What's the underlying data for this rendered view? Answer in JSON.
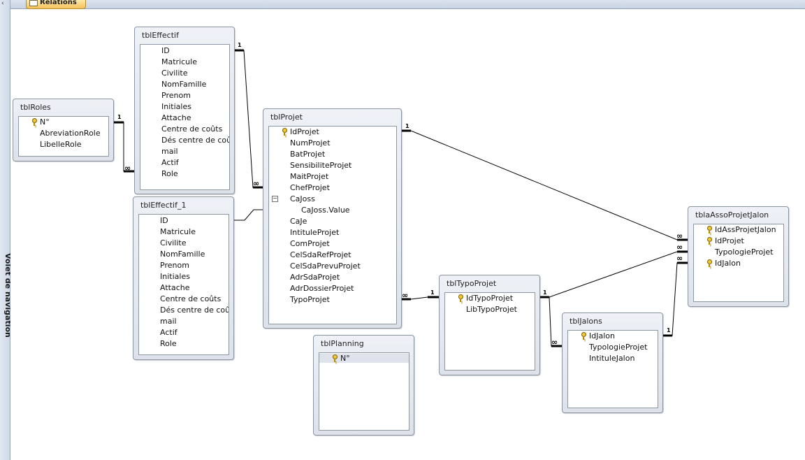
{
  "nav_pane": {
    "label": "Volet de navigation"
  },
  "tab": {
    "label": "Relations"
  },
  "tables": {
    "tblEffectif": {
      "title": "tblEffectif",
      "fields": [
        "ID",
        "Matricule",
        "Civilite",
        "NomFamille",
        "Prenom",
        "Initiales",
        "Attache",
        "Centre de coûts",
        "Dés centre de coût",
        "mail",
        "Actif",
        "Role"
      ]
    },
    "tblRoles": {
      "title": "tblRoles",
      "fields": [
        "N°",
        "AbreviationRole",
        "LibelleRole"
      ]
    },
    "tblEffectif_1": {
      "title": "tblEffectif_1",
      "fields": [
        "ID",
        "Matricule",
        "Civilite",
        "NomFamille",
        "Prenom",
        "Initiales",
        "Attache",
        "Centre de coûts",
        "Dés centre de coût",
        "mail",
        "Actif",
        "Role"
      ]
    },
    "tblProjet": {
      "title": "tblProjet",
      "fields": [
        "IdProjet",
        "NumProjet",
        "BatProjet",
        "SensibiliteProjet",
        "MaitProjet",
        "ChefProjet",
        "CaJoss",
        "CaJoss.Value",
        "CaJe",
        "IntituleProjet",
        "ComProjet",
        "CelSdaRefProjet",
        "CelSdaPrevuProjet",
        "AdrSdaProjet",
        "AdrDossierProjet",
        "TypoProjet"
      ]
    },
    "tblPlanning": {
      "title": "tblPlanning",
      "fields": [
        "N°"
      ]
    },
    "tblTypoProjet": {
      "title": "tblTypoProjet",
      "fields": [
        "IdTypoProjet",
        "LibTypoProjet"
      ]
    },
    "tblJalons": {
      "title": "tblJalons",
      "fields": [
        "IdJalon",
        "TypologieProjet",
        "IntituleJalon"
      ]
    },
    "tblaAssoProjetJalon": {
      "title": "tblaAssoProjetJalon",
      "fields": [
        "IdAssProjetJalon",
        "IdProjet",
        "TypologieProjet",
        "IdJalon"
      ]
    }
  },
  "relationships": {
    "one_label": "1",
    "many_label": "∞"
  },
  "icons": {
    "primary_key": "key-icon",
    "expander": "minus-box-icon"
  },
  "colors": {
    "canvas": "#ffffff",
    "table_header": "#dde2ea",
    "key": "#f2c733",
    "tab": "#f4c15a"
  }
}
